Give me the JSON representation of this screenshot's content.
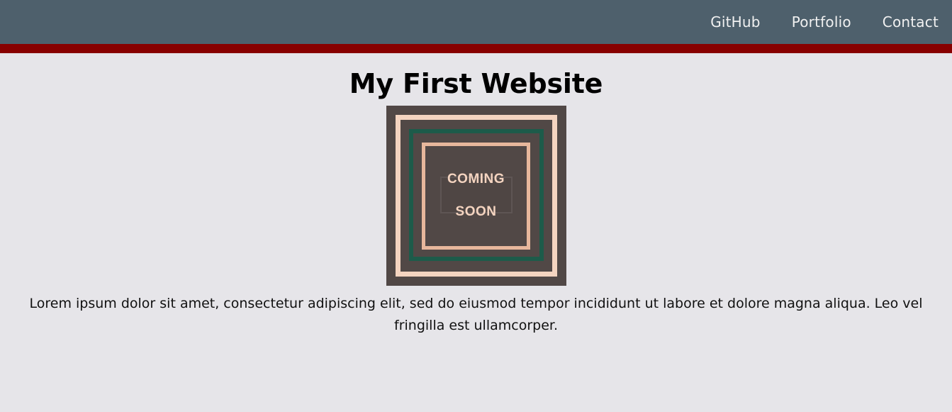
{
  "nav": {
    "links": [
      {
        "label": "GitHub"
      },
      {
        "label": "Portfolio"
      },
      {
        "label": "Contact"
      }
    ]
  },
  "main": {
    "title": "My First Website",
    "hero_image": {
      "caption_line1": "COMING",
      "caption_line2": "SOON"
    },
    "paragraph": "Lorem ipsum dolor sit amet, consectetur adipiscing elit, sed do eiusmod tempor incididunt ut labore et dolore magna aliqua. Leo vel fringilla est ullamcorper."
  },
  "colors": {
    "navbar": "#4e606c",
    "accent_bar": "#880000",
    "page_background": "#e6e5e9",
    "hero_background": "#514846",
    "hero_peach": "#f4d4c0",
    "hero_green": "#1d5b4a"
  }
}
